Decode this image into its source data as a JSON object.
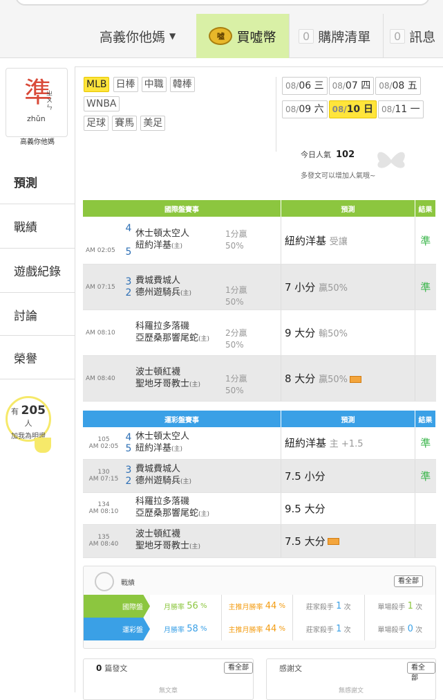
{
  "header": {
    "user": "高義你他媽",
    "buy_coin": "買噓幣",
    "coin_glyph": "噓",
    "shopping_count": "0",
    "shopping_label": "購牌清單",
    "message_count": "0",
    "message_label": "訊息"
  },
  "sidebar": {
    "avatar_char": "準",
    "avatar_zhuyin": "ㄓ\nㄨ\nㄣ",
    "avatar_pinyin": "zhǔn",
    "username": "高義你他媽",
    "items": [
      {
        "label": "預測"
      },
      {
        "label": "戰績"
      },
      {
        "label": "遊戲紀錄"
      },
      {
        "label": "討論"
      },
      {
        "label": "榮譽"
      }
    ],
    "fans_prefix": "有",
    "fans_count": "205",
    "fans_suffix": "人",
    "fans_text": "加我為明燈"
  },
  "sports": [
    {
      "label": "MLB",
      "active": true
    },
    {
      "label": "日棒"
    },
    {
      "label": "中職"
    },
    {
      "label": "韓棒"
    },
    {
      "label": "WNBA"
    },
    {
      "label": "足球"
    },
    {
      "label": "賽馬"
    },
    {
      "label": "美足"
    }
  ],
  "dates": [
    {
      "m": "08/",
      "d": "06",
      "w": "三"
    },
    {
      "m": "08/",
      "d": "07",
      "w": "四"
    },
    {
      "m": "08/",
      "d": "08",
      "w": "五"
    },
    {
      "m": "08/",
      "d": "09",
      "w": "六"
    },
    {
      "m": "08/",
      "d": "10",
      "w": "日",
      "active": true
    },
    {
      "m": "08/",
      "d": "11",
      "w": "一"
    }
  ],
  "popularity": {
    "label": "今日人氣",
    "value": "102",
    "hint": "多發文可以增加人氣哦~"
  },
  "intl": {
    "h_game": "國際盤賽事",
    "h_pred": "預測",
    "h_res": "結果",
    "rows": [
      {
        "time": "AM 02:05",
        "s1": "4",
        "t1": "休士頓太空人",
        "s2": "5",
        "t2": "紐約洋基",
        "host": "(主)",
        "hc": "1分贏",
        "hcp": "50%",
        "pred": "紐約洋基",
        "pred_sub": "受讓",
        "res": "準"
      },
      {
        "time": "AM 07:15",
        "s1": "3",
        "t1": "費城費城人",
        "s2": "2",
        "t2": "德州遊騎兵",
        "host": "(主)",
        "hc": "1分贏",
        "hcp": "50%",
        "pred": "7 小分",
        "pred_sub": "贏50%",
        "res": "準"
      },
      {
        "time": "AM 08:10",
        "s1": "",
        "t1": "科羅拉多落磯",
        "s2": "",
        "t2": "亞歷桑那響尾蛇",
        "host": "(主)",
        "hc": "2分贏",
        "hcp": "50%",
        "pred": "9 大分",
        "pred_sub": "輸50%",
        "res": ""
      },
      {
        "time": "AM 08:40",
        "s1": "",
        "t1": "波士頓紅襪",
        "s2": "",
        "t2": "聖地牙哥教士",
        "host": "(主)",
        "hc": "1分贏",
        "hcp": "50%",
        "pred": "8 大分",
        "pred_sub": "贏50%",
        "res": ""
      }
    ]
  },
  "lottery": {
    "h_game": "運彩盤賽事",
    "h_pred": "預測",
    "h_res": "結果",
    "rows": [
      {
        "no": "105",
        "time": "AM 02:05",
        "s1": "4",
        "t1": "休士頓太空人",
        "s2": "5",
        "t2": "紐約洋基",
        "host": "(主)",
        "pred": "紐約洋基",
        "pred_sub": "主 +1.5",
        "res": "準"
      },
      {
        "no": "130",
        "time": "AM 07:15",
        "s1": "3",
        "t1": "費城費城人",
        "s2": "2",
        "t2": "德州遊騎兵",
        "host": "(主)",
        "pred": "7.5 小分",
        "pred_sub": "",
        "res": "準"
      },
      {
        "no": "134",
        "time": "AM 08:10",
        "s1": "",
        "t1": "科羅拉多落磯",
        "s2": "",
        "t2": "亞歷桑那響尾蛇",
        "host": "(主)",
        "pred": "9.5 大分",
        "pred_sub": "",
        "res": ""
      },
      {
        "no": "135",
        "time": "AM 08:40",
        "s1": "",
        "t1": "波士頓紅襪",
        "s2": "",
        "t2": "聖地牙哥教士",
        "host": "(主)",
        "pred": "7.5 大分",
        "pred_sub": "",
        "res": ""
      }
    ]
  },
  "stats": {
    "title": "戰績",
    "view_all": "看全部",
    "intl": {
      "label": "國際盤",
      "month_label": "月勝率",
      "month": "56",
      "main_label": "主推月勝率",
      "main": "44",
      "pct": "%",
      "bank_label": "莊家殺手",
      "bank": "1",
      "single_label": "單場殺手",
      "single": "1",
      "unit": "次"
    },
    "lottery": {
      "label": "運彩盤",
      "month_label": "月勝率",
      "month": "58",
      "main_label": "主推月勝率",
      "main": "44",
      "pct": "%",
      "bank_label": "莊家殺手",
      "bank": "1",
      "single_label": "單場殺手",
      "single": "0",
      "unit": "次"
    }
  },
  "posts": {
    "count": "0",
    "label": "篇發文",
    "view_all": "看全部",
    "empty": "無文章"
  },
  "thanks": {
    "label": "感謝文",
    "view_all": "看全部",
    "empty": "無感謝文"
  },
  "colors": {
    "intl": "#8cc63f",
    "lottery": "#3aa0e6",
    "highlight": "#ffe53b",
    "win": "#39b54a"
  }
}
